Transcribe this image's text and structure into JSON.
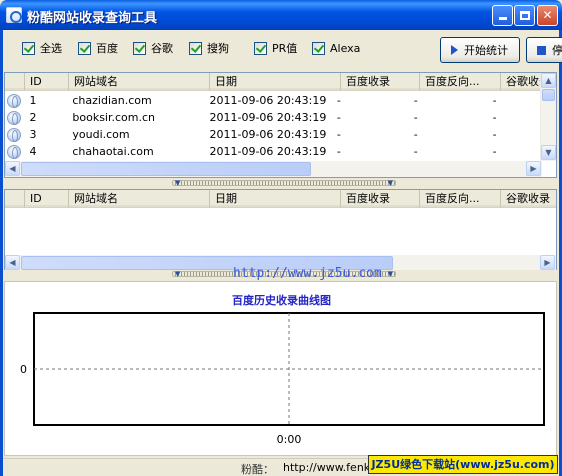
{
  "window": {
    "title": "粉酷网站收录查询工具",
    "icon": "app-icon"
  },
  "options": [
    {
      "label": "全选",
      "checked": true
    },
    {
      "label": "百度",
      "checked": true
    },
    {
      "label": "谷歌",
      "checked": true
    },
    {
      "label": "搜狗",
      "checked": true
    },
    {
      "label": "PR值",
      "checked": true
    },
    {
      "label": "Alexa",
      "checked": true
    }
  ],
  "toolbar": {
    "start_label": "开始统计",
    "stop_label": "停"
  },
  "table": {
    "columns": [
      "",
      "ID",
      "网站域名",
      "日期",
      "百度收录",
      "百度反向...",
      "谷歌收录"
    ],
    "rows": [
      {
        "id": "1",
        "domain": "chazidian.com",
        "date": "2011-09-06 20:43:19",
        "baidu": "-",
        "baidu_back": "-",
        "google": "-"
      },
      {
        "id": "2",
        "domain": "booksir.com.cn",
        "date": "2011-09-06 20:43:19",
        "baidu": "-",
        "baidu_back": "-",
        "google": "-"
      },
      {
        "id": "3",
        "domain": "youdi.com",
        "date": "2011-09-06 20:43:19",
        "baidu": "-",
        "baidu_back": "-",
        "google": "-"
      },
      {
        "id": "4",
        "domain": "chahaotai.com",
        "date": "2011-09-06 20:43:19",
        "baidu": "-",
        "baidu_back": "-",
        "google": "-"
      }
    ]
  },
  "history_table": {
    "columns": [
      "",
      "ID",
      "网站域名",
      "日期",
      "百度收录",
      "百度反向...",
      "谷歌收录"
    ]
  },
  "watermark": "http://www.jz5u.com",
  "chart_data": {
    "type": "line",
    "title": "百度历史收录曲线图",
    "x_ticks": [
      "0:00"
    ],
    "y_ticks": [
      "0"
    ],
    "series": [],
    "grid": true
  },
  "status": {
    "label": "粉酷：",
    "url": "http://www.fenku"
  },
  "badge": "JZ5U绿色下载站(www.jz5u.com)"
}
